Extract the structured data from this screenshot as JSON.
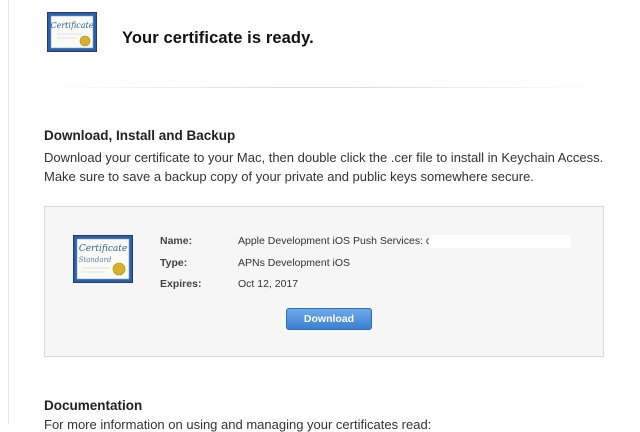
{
  "header": {
    "icon": "certificate-icon",
    "title": "Your certificate is ready."
  },
  "install_section": {
    "title": "Download, Install and Backup",
    "description": "Download your certificate to your Mac, then double click the .cer file to install in Keychain Access. Make sure to save a backup copy of your private and public keys somewhere secure."
  },
  "certificate": {
    "icon": "certificate-standard-icon",
    "icon_caption": "Certificate",
    "icon_subcaption": "Standard",
    "name_label": "Name:",
    "name_value": "Apple Development iOS Push Services: c",
    "type_label": "Type:",
    "type_value": "APNs Development iOS",
    "expires_label": "Expires:",
    "expires_value": "Oct 12, 2017",
    "download_label": "Download"
  },
  "documentation": {
    "title": "Documentation",
    "description": "For more information on using and managing your certificates read:"
  },
  "colors": {
    "button_blue": "#3b7fd2",
    "certificate_blue": "#2d5fa8",
    "seal_gold": "#d8b12c"
  }
}
